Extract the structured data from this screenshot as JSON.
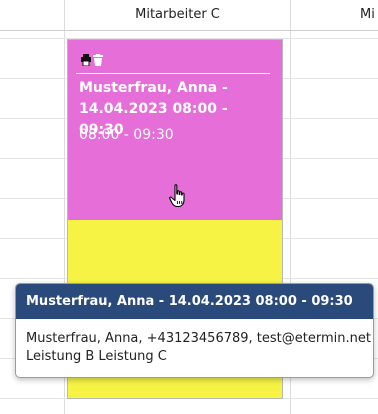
{
  "calendar": {
    "columns": [
      {
        "label": ""
      },
      {
        "label": "Mitarbeiter C"
      },
      {
        "label": "Mi"
      }
    ]
  },
  "appointment": {
    "title": "Musterfrau, Anna - 14.04.2023 08:00 - 09:30",
    "time": "08:00 - 09:30",
    "icons": [
      "print-icon",
      "trash-icon"
    ],
    "colors": {
      "primary": "#e56ed9",
      "secondary": "#f6f345"
    }
  },
  "tooltip": {
    "title": "Musterfrau, Anna - 14.04.2023 08:00 - 09:30",
    "details": "Musterfrau, Anna, +43123456789, test@etermin.net",
    "services": "Leistung B Leistung C",
    "header_color": "#2a4a7c"
  }
}
